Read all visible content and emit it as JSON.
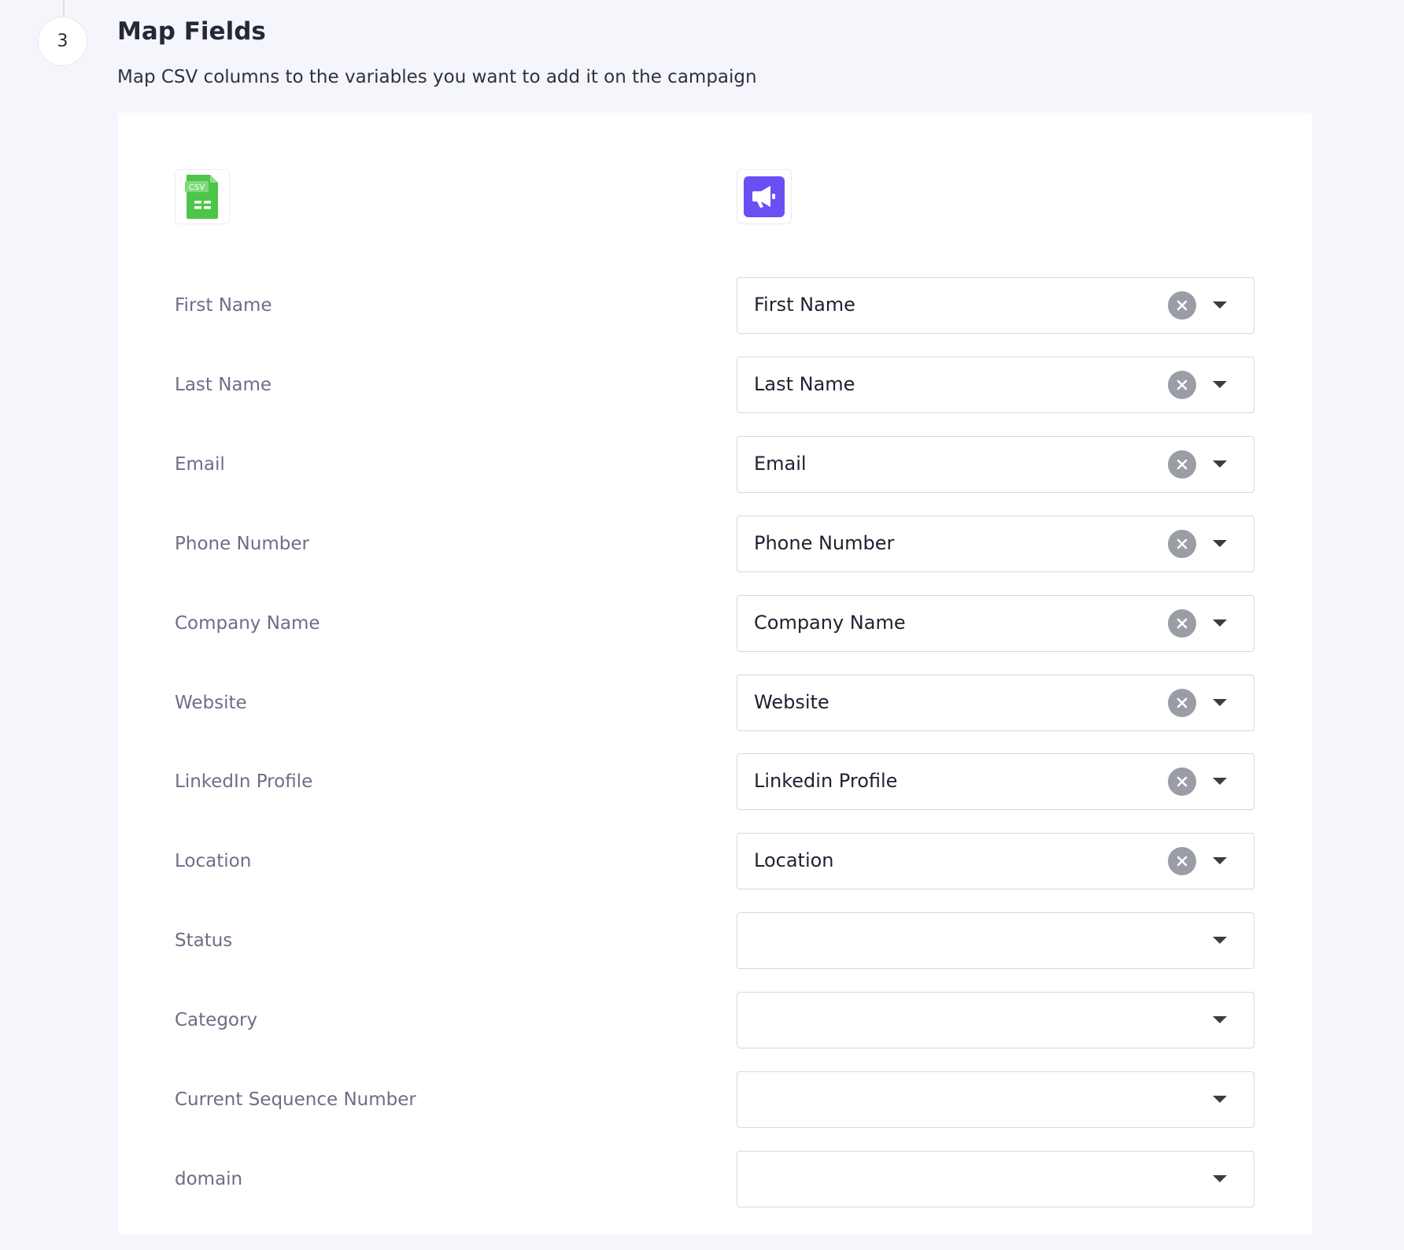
{
  "step": {
    "number": "3",
    "title": "Map Fields",
    "description": "Map CSV columns to the variables you want to add it on the campaign"
  },
  "logos": {
    "csv_text": "CSV",
    "csv_color": "#4cc64a",
    "app_color": "#6b4ff6"
  },
  "fields": [
    {
      "label": "First Name",
      "value": "First Name"
    },
    {
      "label": "Last Name",
      "value": "Last Name"
    },
    {
      "label": "Email",
      "value": "Email"
    },
    {
      "label": "Phone Number",
      "value": "Phone Number"
    },
    {
      "label": "Company Name",
      "value": "Company Name"
    },
    {
      "label": "Website",
      "value": "Website"
    },
    {
      "label": "LinkedIn Profile",
      "value": "Linkedin Profile"
    },
    {
      "label": "Location",
      "value": "Location"
    },
    {
      "label": "Status",
      "value": ""
    },
    {
      "label": "Category",
      "value": ""
    },
    {
      "label": "Current Sequence Number",
      "value": ""
    },
    {
      "label": "domain",
      "value": ""
    }
  ]
}
